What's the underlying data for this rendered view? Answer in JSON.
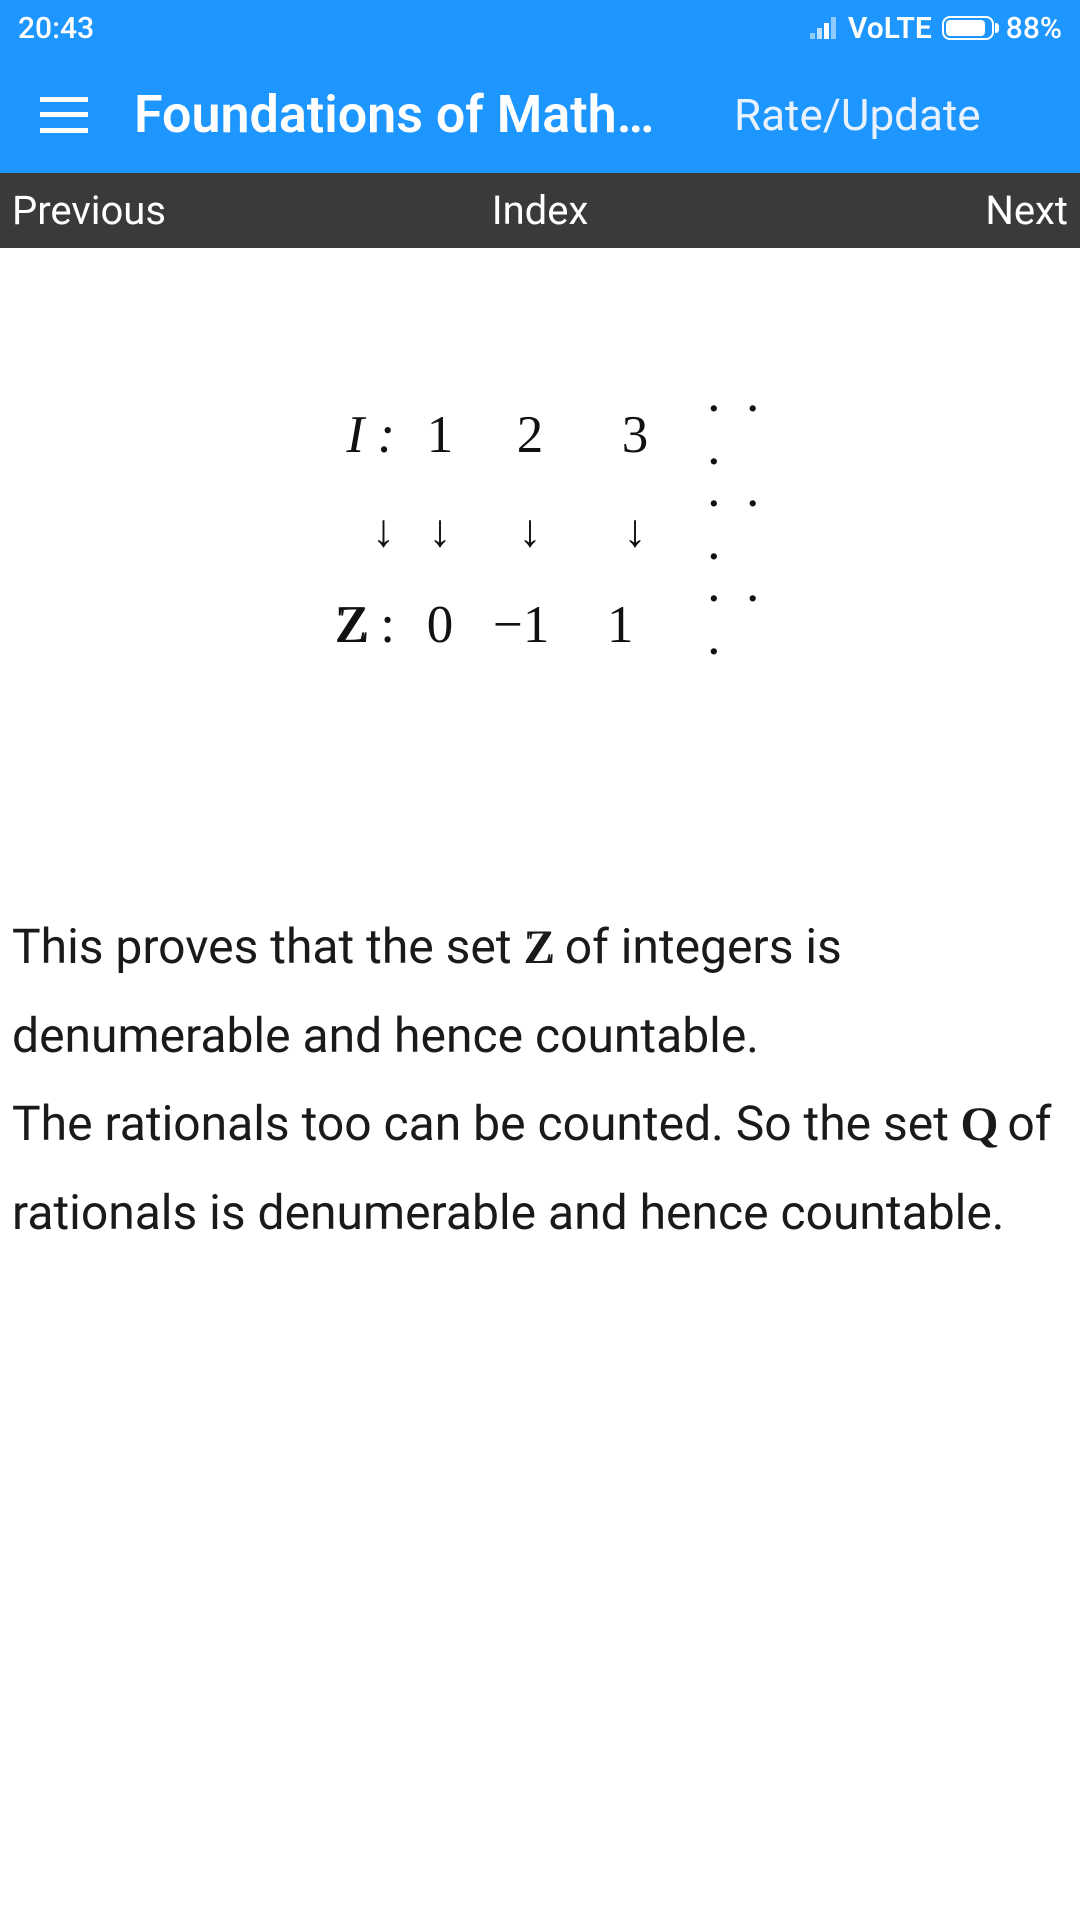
{
  "status": {
    "time": "20:43",
    "network": "VoLTE",
    "battery": "88%"
  },
  "header": {
    "title": "Foundations of Math…",
    "rate_label": "Rate/Update"
  },
  "nav": {
    "prev": "Previous",
    "index": "Index",
    "next": "Next"
  },
  "math": {
    "row1_label": "I :",
    "row1": [
      "1",
      "2",
      "3",
      "· · ·"
    ],
    "row2_label": "↓",
    "row2": [
      "↓",
      "↓",
      "↓",
      "· · ·"
    ],
    "row3_label": "ℤ :",
    "row3": [
      "0",
      "−1",
      "1",
      "· · ·"
    ]
  },
  "body": {
    "p1_a": "This proves that the set ",
    "p1_z": "Z",
    "p1_b": " of integers is denumerable and hence countable.",
    "p2_a": "The rationals too can be counted. So the set ",
    "p2_q": "Q",
    "p2_b": " of rationals is denumerable and hence countable."
  }
}
